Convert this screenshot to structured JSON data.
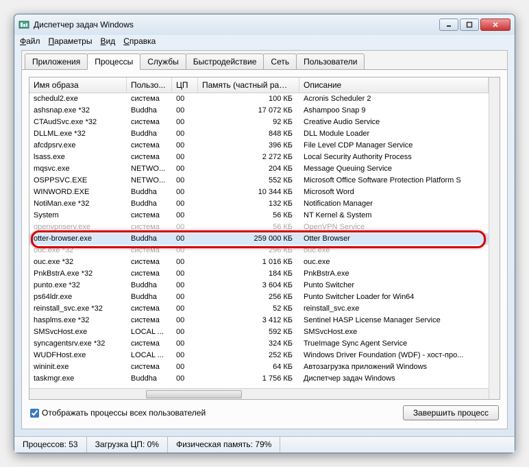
{
  "window": {
    "title": "Диспетчер задач Windows"
  },
  "menu": [
    "Файл",
    "Параметры",
    "Вид",
    "Справка"
  ],
  "tabs": {
    "items": [
      "Приложения",
      "Процессы",
      "Службы",
      "Быстродействие",
      "Сеть",
      "Пользователи"
    ],
    "active": 1
  },
  "columns": {
    "image": "Имя образа",
    "user": "Пользо...",
    "cpu": "ЦП",
    "mem": "Память (частный рабо...",
    "desc": "Описание"
  },
  "rows": [
    {
      "img": "schedul2.exe",
      "user": "система",
      "cpu": "00",
      "mem": "100 КБ",
      "desc": "Acronis Scheduler 2"
    },
    {
      "img": "ashsnap.exe *32",
      "user": "Buddha",
      "cpu": "00",
      "mem": "17 072 КБ",
      "desc": "Ashampoo Snap 9"
    },
    {
      "img": "CTAudSvc.exe *32",
      "user": "система",
      "cpu": "00",
      "mem": "92 КБ",
      "desc": "Creative Audio Service"
    },
    {
      "img": "DLLML.exe *32",
      "user": "Buddha",
      "cpu": "00",
      "mem": "848 КБ",
      "desc": "DLL Module Loader"
    },
    {
      "img": "afcdpsrv.exe",
      "user": "система",
      "cpu": "00",
      "mem": "396 КБ",
      "desc": "File Level CDP Manager Service"
    },
    {
      "img": "lsass.exe",
      "user": "система",
      "cpu": "00",
      "mem": "2 272 КБ",
      "desc": "Local Security Authority Process"
    },
    {
      "img": "mqsvc.exe",
      "user": "NETWO...",
      "cpu": "00",
      "mem": "204 КБ",
      "desc": "Message Queuing Service"
    },
    {
      "img": "OSPPSVC.EXE",
      "user": "NETWO...",
      "cpu": "00",
      "mem": "552 КБ",
      "desc": "Microsoft Office Software Protection Platform S"
    },
    {
      "img": "WINWORD.EXE",
      "user": "Buddha",
      "cpu": "00",
      "mem": "10 344 КБ",
      "desc": "Microsoft Word"
    },
    {
      "img": "NotiMan.exe *32",
      "user": "Buddha",
      "cpu": "00",
      "mem": "132 КБ",
      "desc": "Notification Manager"
    },
    {
      "img": "System",
      "user": "система",
      "cpu": "00",
      "mem": "56 КБ",
      "desc": "NT Kernel & System"
    },
    {
      "img": "openvpnserv.exe",
      "user": "система",
      "cpu": "00",
      "mem": "56 КБ",
      "desc": "OpenVPN Service",
      "cut": true
    },
    {
      "img": "otter-browser.exe",
      "user": "Buddha",
      "cpu": "00",
      "mem": "259 000 КБ",
      "desc": "Otter Browser",
      "selected": true
    },
    {
      "img": "ouc.exe *32",
      "user": "система",
      "cpu": "00",
      "mem": "296 КБ",
      "desc": "ouc.exe",
      "cut": true
    },
    {
      "img": "ouc.exe *32",
      "user": "система",
      "cpu": "00",
      "mem": "1 016 КБ",
      "desc": "ouc.exe"
    },
    {
      "img": "PnkBstrA.exe *32",
      "user": "система",
      "cpu": "00",
      "mem": "184 КБ",
      "desc": "PnkBstrA.exe"
    },
    {
      "img": "punto.exe *32",
      "user": "Buddha",
      "cpu": "00",
      "mem": "3 604 КБ",
      "desc": "Punto Switcher"
    },
    {
      "img": "ps64ldr.exe",
      "user": "Buddha",
      "cpu": "00",
      "mem": "256 КБ",
      "desc": "Punto Switcher Loader for Win64"
    },
    {
      "img": "reinstall_svc.exe *32",
      "user": "система",
      "cpu": "00",
      "mem": "52 КБ",
      "desc": "reinstall_svc.exe"
    },
    {
      "img": "hasplms.exe *32",
      "user": "система",
      "cpu": "00",
      "mem": "3 412 КБ",
      "desc": "Sentinel HASP License Manager Service"
    },
    {
      "img": "SMSvcHost.exe",
      "user": "LOCAL ...",
      "cpu": "00",
      "mem": "592 КБ",
      "desc": "SMSvcHost.exe"
    },
    {
      "img": "syncagentsrv.exe *32",
      "user": "система",
      "cpu": "00",
      "mem": "324 КБ",
      "desc": "TrueImage Sync Agent Service"
    },
    {
      "img": "WUDFHost.exe",
      "user": "LOCAL ...",
      "cpu": "00",
      "mem": "252 КБ",
      "desc": "Windows Driver Foundation (WDF) - хост-про..."
    },
    {
      "img": "wininit.exe",
      "user": "система",
      "cpu": "00",
      "mem": "64 КБ",
      "desc": "Автозагрузка приложений Windows"
    },
    {
      "img": "taskmgr.exe",
      "user": "Buddha",
      "cpu": "00",
      "mem": "1 756 КБ",
      "desc": "Диспетчер задач Windows"
    }
  ],
  "checkbox": {
    "label": "Отображать процессы всех пользователей",
    "checked": true
  },
  "button": {
    "end": "Завершить процесс"
  },
  "status": {
    "procs": "Процессов: 53",
    "cpu": "Загрузка ЦП: 0%",
    "mem": "Физическая память: 79%"
  },
  "highlight_row_index": 12
}
